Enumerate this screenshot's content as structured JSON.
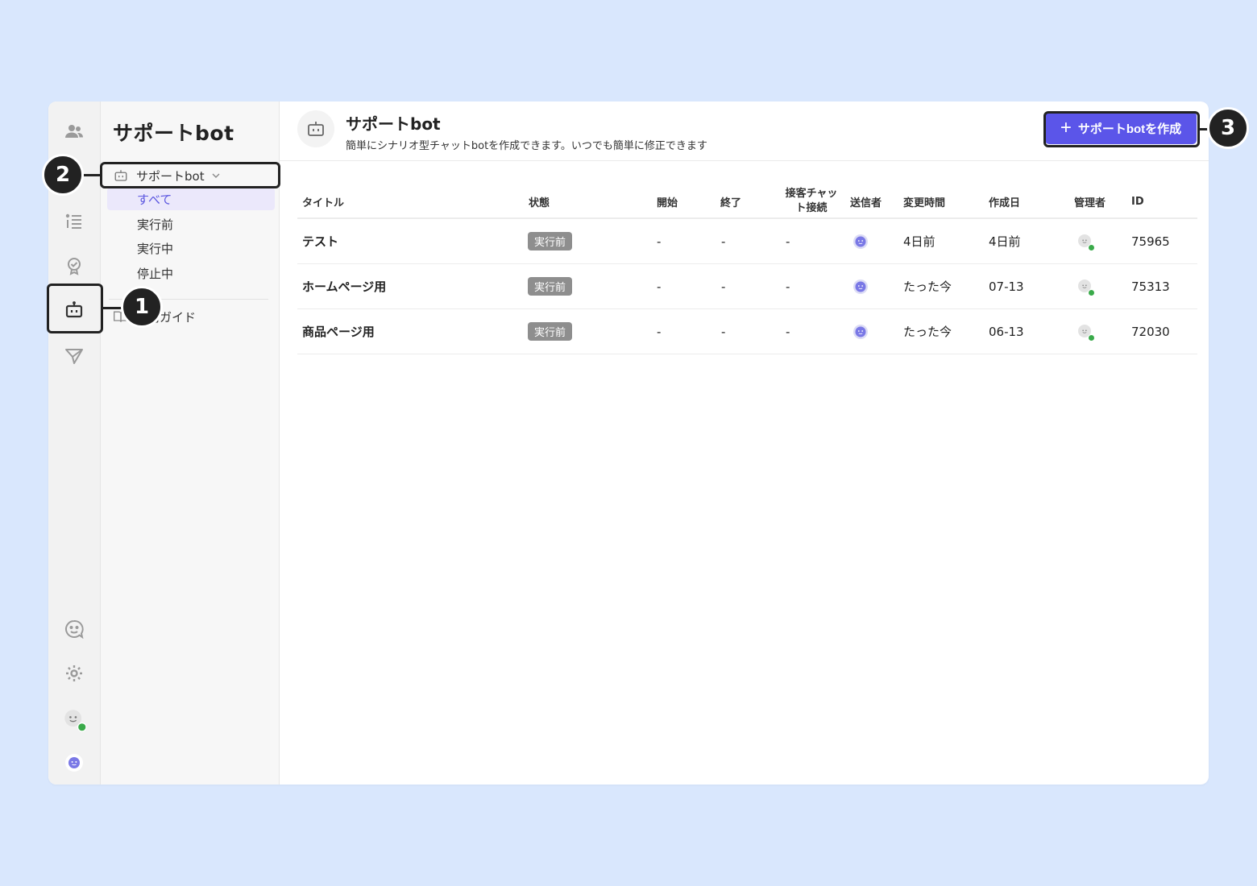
{
  "rail": {
    "items": [
      {
        "name": "users",
        "active": false
      },
      {
        "name": "list",
        "active": false
      },
      {
        "name": "award",
        "active": false
      },
      {
        "name": "bot",
        "active": true
      },
      {
        "name": "send",
        "active": false
      }
    ],
    "bottom": [
      "chat-face",
      "settings",
      "admin-avatar",
      "bot-avatar"
    ]
  },
  "subsidebar": {
    "title": "サポートbot",
    "section_label": "サポートbot",
    "filters": [
      {
        "label": "すべて",
        "active": true
      },
      {
        "label": "実行前",
        "active": false
      },
      {
        "label": "実行中",
        "active": false
      },
      {
        "label": "停止中",
        "active": false
      }
    ],
    "guide_label": "利用ガイド"
  },
  "header": {
    "title": "サポートbot",
    "description": "簡単にシナリオ型チャットbotを作成できます。いつでも簡単に修正できます",
    "create_button": "サポートbotを作成",
    "create_plus": "+"
  },
  "table": {
    "columns": {
      "title": "タイトル",
      "status": "状態",
      "start": "開始",
      "end": "終了",
      "chat_line1": "接客チャッ",
      "chat_line2": "ト接続",
      "sender": "送信者",
      "modified": "変更時間",
      "created": "作成日",
      "admin": "管理者",
      "id": "ID"
    },
    "rows": [
      {
        "title": "テスト",
        "status": "実行前",
        "start": "-",
        "end": "-",
        "chat": "-",
        "modified": "4日前",
        "created": "4日前",
        "id": "75965"
      },
      {
        "title": "ホームページ用",
        "status": "実行前",
        "start": "-",
        "end": "-",
        "chat": "-",
        "modified": "たった今",
        "created": "07-13",
        "id": "75313"
      },
      {
        "title": "商品ページ用",
        "status": "実行前",
        "start": "-",
        "end": "-",
        "chat": "-",
        "modified": "たった今",
        "created": "06-13",
        "id": "72030"
      }
    ]
  },
  "callouts": [
    "1",
    "2",
    "3"
  ],
  "colors": {
    "accent": "#5b55e9",
    "active_filter_bg": "#ebe8fb",
    "badge": "#8e8e8e",
    "online": "#3aaa4a",
    "backdrop": "#d9e7fd"
  }
}
